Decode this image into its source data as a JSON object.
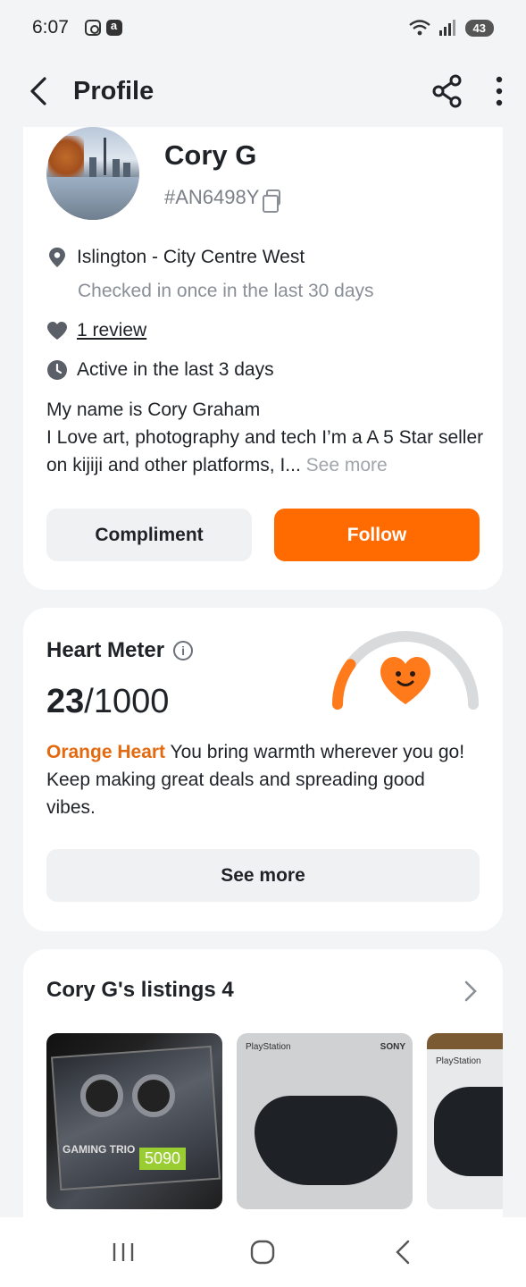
{
  "status_bar": {
    "time": "6:07",
    "battery": "43"
  },
  "header": {
    "title": "Profile"
  },
  "profile": {
    "name": "Cory G",
    "user_id": "#AN6498Y",
    "location": "Islington - City Centre West",
    "checkin": "Checked in once in the last 30 days",
    "reviews": "1 review",
    "activity": "Active in the last 3 days",
    "bio_line1": "My name is Cory Graham",
    "bio_line2": "I Love art, photography and tech I’m a A 5 Star seller on kijiji and other platforms, I...",
    "bio_more": "See more",
    "compliment_label": "Compliment",
    "follow_label": "Follow"
  },
  "heart_meter": {
    "title": "Heart Meter",
    "score": "23",
    "max": "/1000",
    "tier": "Orange Heart",
    "description": " You bring warmth wherever you go! Keep making great deals and spreading good vibes.",
    "see_more_label": "See more",
    "progress_fraction": 0.023,
    "accent_color": "#ff7a1a"
  },
  "listings": {
    "title": "Cory G's listings 4",
    "items": [
      {
        "icon": "gpu-box-photo",
        "brand": "GAMING TRIO",
        "badge": "5090"
      },
      {
        "icon": "controller-box-photo",
        "label": "PlayStation",
        "maker": "SONY"
      },
      {
        "icon": "controller-box-photo",
        "label": "PlayStation"
      }
    ]
  },
  "colors": {
    "brand_orange": "#ff6b00",
    "background": "#f3f4f6"
  }
}
